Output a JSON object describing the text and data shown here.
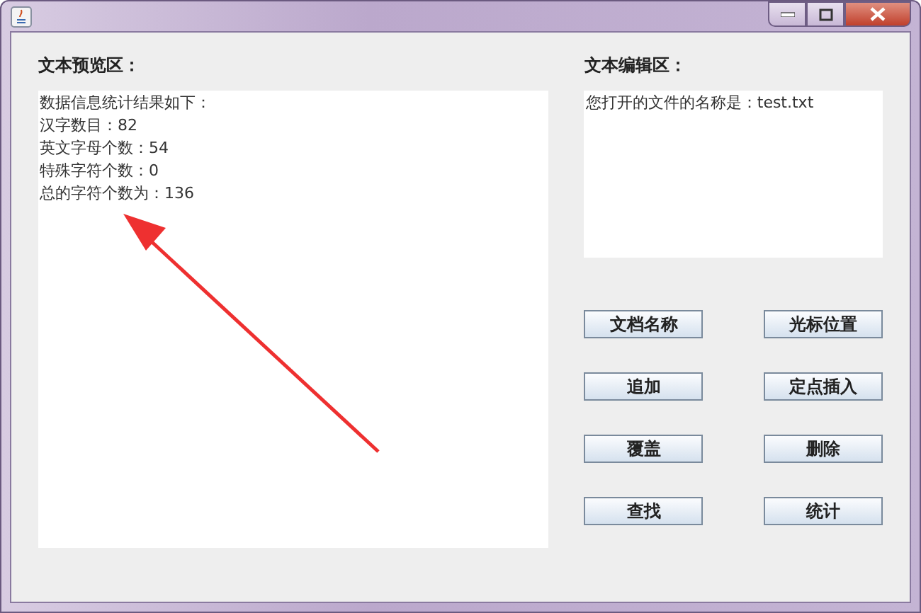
{
  "preview": {
    "label": "文本预览区：",
    "lines": [
      "数据信息统计结果如下：",
      "汉字数目：82",
      "英文字母个数：54",
      "特殊字符个数：0",
      "总的字符个数为：136"
    ]
  },
  "editor": {
    "label": "文本编辑区：",
    "lines": [
      "您打开的文件的名称是：test.txt"
    ]
  },
  "buttons": [
    "文档名称",
    "光标位置",
    "追加",
    "定点插入",
    "覆盖",
    "删除",
    "查找",
    "统计"
  ],
  "annotation": {
    "kind": "arrow"
  }
}
